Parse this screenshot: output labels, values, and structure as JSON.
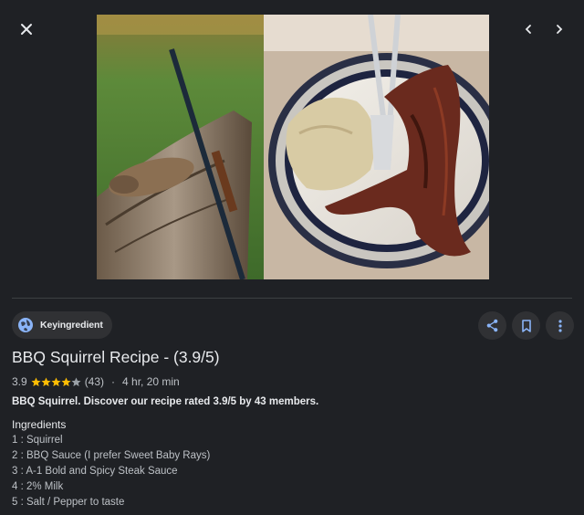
{
  "source": {
    "name": "Keyingredient"
  },
  "title": "BBQ Squirrel Recipe - (3.9/5)",
  "rating": {
    "value": "3.9",
    "stars": 4,
    "count": "(43)",
    "separator": "·",
    "time": "4 hr, 20 min"
  },
  "description": "BBQ Squirrel. Discover our recipe rated 3.9/5 by 43 members.",
  "ingredients": {
    "heading": "Ingredients",
    "items": [
      "1 : Squirrel",
      "2 : BBQ Sauce (I prefer Sweet Baby Rays)",
      "3 : A-1 Bold and Spicy Steak Sauce",
      "4 : 2% Milk",
      "5 : Salt / Pepper to taste"
    ]
  },
  "icons": {
    "close": "close-icon",
    "prev": "chevron-left-icon",
    "next": "chevron-right-icon",
    "globe": "globe-icon",
    "share": "share-icon",
    "save": "bookmark-icon",
    "more": "more-vert-icon"
  },
  "colors": {
    "background": "#1f2125",
    "star": "#fbbc04",
    "chip": "#303134",
    "accent": "#8ab4f8"
  }
}
